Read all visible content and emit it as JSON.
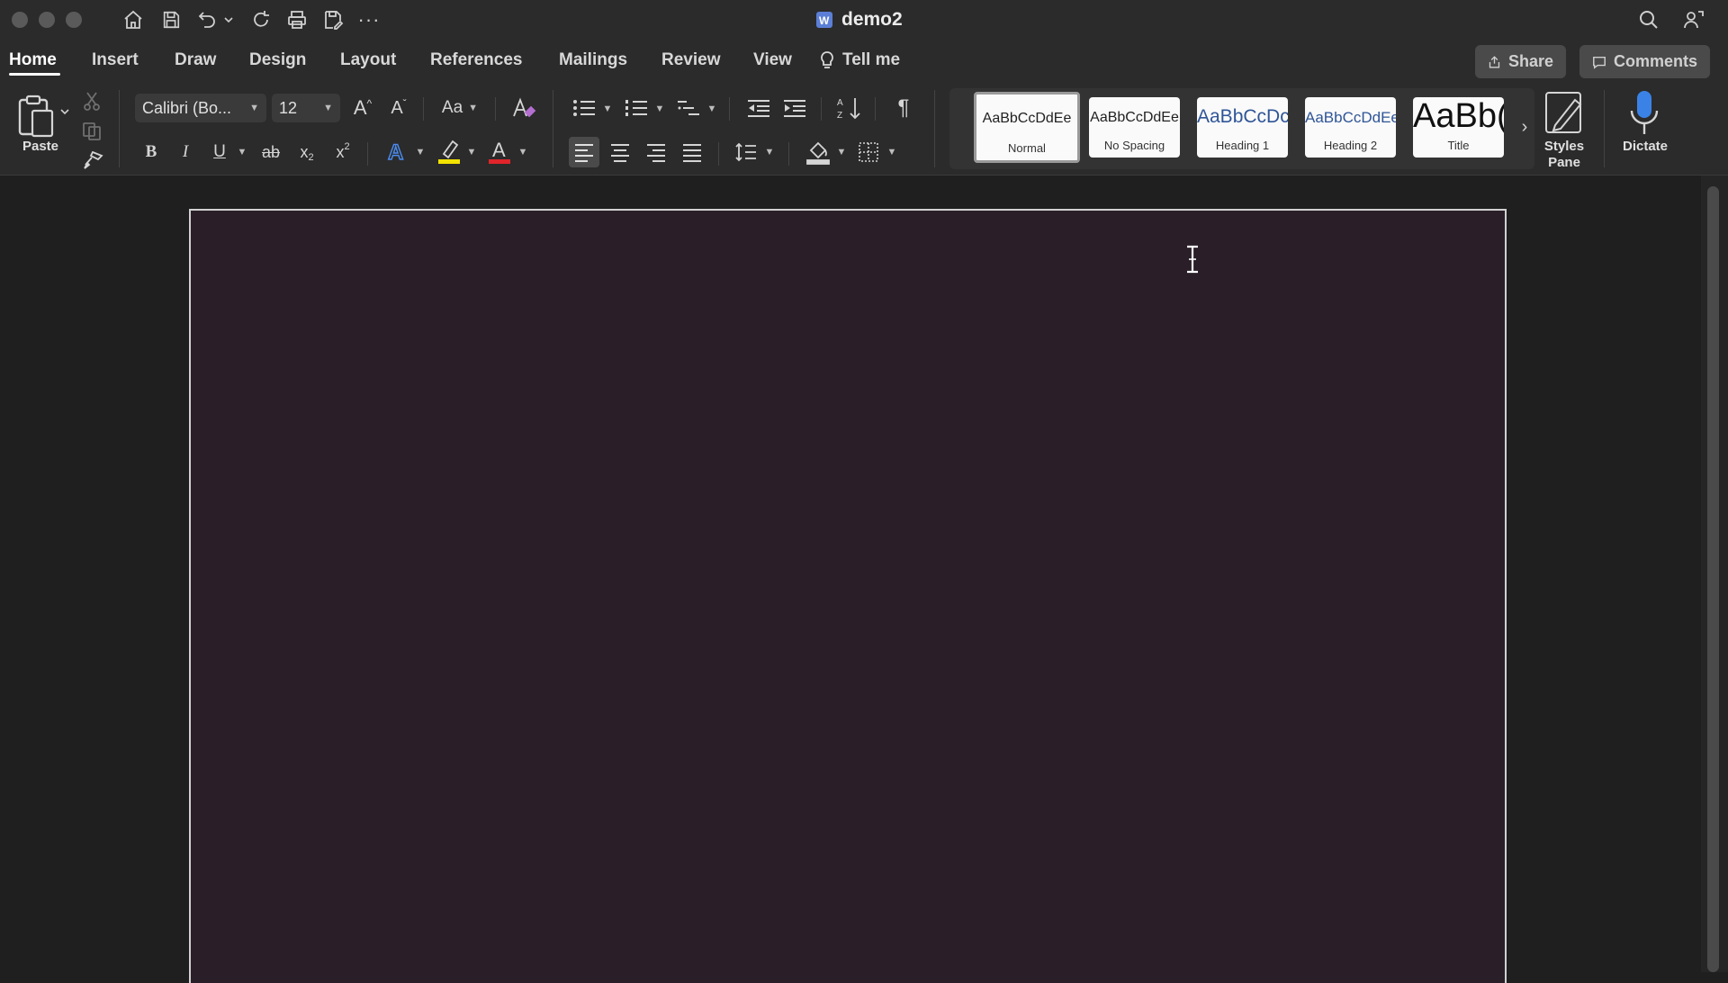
{
  "window": {
    "title": "demo2"
  },
  "tabs": [
    {
      "label": "Home",
      "active": true
    },
    {
      "label": "Insert"
    },
    {
      "label": "Draw"
    },
    {
      "label": "Design"
    },
    {
      "label": "Layout"
    },
    {
      "label": "References"
    },
    {
      "label": "Mailings"
    },
    {
      "label": "Review"
    },
    {
      "label": "View"
    },
    {
      "label": "Tell me"
    }
  ],
  "actions": {
    "share": "Share",
    "comments": "Comments"
  },
  "clipboard": {
    "paste_label": "Paste"
  },
  "font": {
    "family": "Calibri (Bo...",
    "size": "12",
    "change_case": "Aa"
  },
  "styles": [
    {
      "sample": "AaBbCcDdEe",
      "name": "Normal",
      "selected": true
    },
    {
      "sample": "AaBbCcDdEe",
      "name": "No Spacing"
    },
    {
      "sample": "AaBbCcDc",
      "name": "Heading 1"
    },
    {
      "sample": "AaBbCcDdEe",
      "name": "Heading 2"
    },
    {
      "sample": "AaBb(",
      "name": "Title"
    }
  ],
  "styles_pane": {
    "label_line1": "Styles",
    "label_line2": "Pane"
  },
  "dictate": {
    "label": "Dictate"
  },
  "colors": {
    "highlight": "#f2e200",
    "font_color": "#e0242a",
    "text_effect": "#4a8cf0",
    "page_bg": "#2a1f28",
    "dictate_mic": "#3b82e6"
  }
}
